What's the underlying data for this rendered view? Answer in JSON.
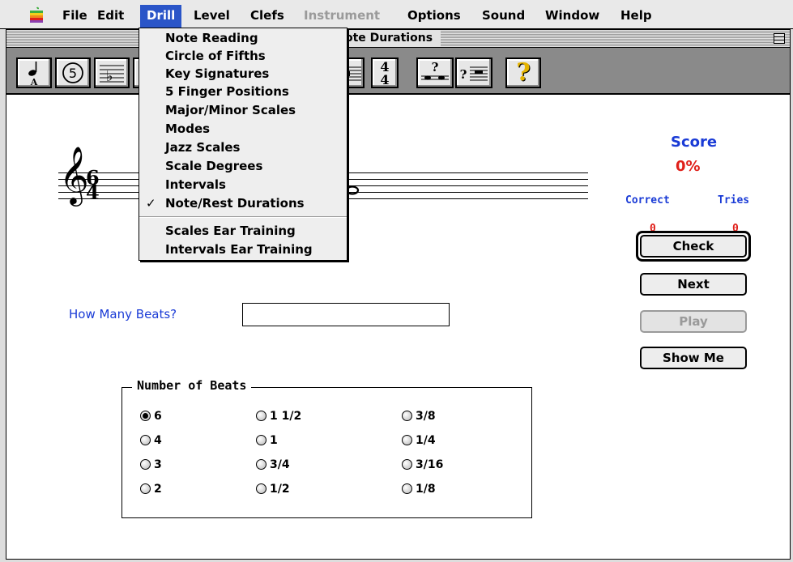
{
  "menubar": {
    "apple_icon": "apple-logo-icon",
    "items": [
      {
        "label": "File",
        "enabled": true
      },
      {
        "label": "Edit",
        "enabled": true
      },
      {
        "label": "Drill",
        "enabled": true,
        "active": true
      },
      {
        "label": "Level",
        "enabled": true
      },
      {
        "label": "Clefs",
        "enabled": true
      },
      {
        "label": "Instrument",
        "enabled": false
      },
      {
        "label": "Options",
        "enabled": true
      },
      {
        "label": "Sound",
        "enabled": true
      },
      {
        "label": "Window",
        "enabled": true
      },
      {
        "label": "Help",
        "enabled": true
      }
    ]
  },
  "drill_menu": {
    "items": [
      {
        "label": "Note Reading",
        "checked": false
      },
      {
        "label": "Circle of Fifths",
        "checked": false
      },
      {
        "label": "Key Signatures",
        "checked": false
      },
      {
        "label": "5 Finger Positions",
        "checked": false
      },
      {
        "label": "Major/Minor Scales",
        "checked": false
      },
      {
        "label": "Modes",
        "checked": false
      },
      {
        "label": "Jazz Scales",
        "checked": false
      },
      {
        "label": "Scale Degrees",
        "checked": false
      },
      {
        "label": "Intervals",
        "checked": false
      },
      {
        "label": "Note/Rest Durations",
        "checked": true
      },
      {
        "label": "Scales Ear Training",
        "checked": false
      },
      {
        "label": "Intervals Ear Training",
        "checked": false
      }
    ],
    "check_mark": "✓"
  },
  "window": {
    "title_visible": "ote Durations"
  },
  "toolbar": {
    "btn_note_letter": "A",
    "btn_circle_fifths": "5",
    "btn_time_sig_top": "4",
    "btn_time_sig_bottom": "4",
    "btn_ear_q": "?",
    "btn_help": "?"
  },
  "score": {
    "label": "Score",
    "value": "0%",
    "correct_label": "Correct",
    "tries_label": "Tries",
    "correct_value": "0",
    "tries_value": "0"
  },
  "staff": {
    "time_sig_top": "6",
    "time_sig_bottom": "4",
    "clef_glyph": "𝄞"
  },
  "buttons": {
    "check": "Check",
    "next": "Next",
    "play": "Play",
    "show_me": "Show Me"
  },
  "question": {
    "label": "How Many Beats?",
    "answer_value": ""
  },
  "beats_group": {
    "legend": "Number of Beats",
    "options": [
      {
        "label": "6",
        "selected": true
      },
      {
        "label": "4",
        "selected": false
      },
      {
        "label": "3",
        "selected": false
      },
      {
        "label": "2",
        "selected": false
      },
      {
        "label": "1 1/2",
        "selected": false
      },
      {
        "label": "1",
        "selected": false
      },
      {
        "label": "3/4",
        "selected": false
      },
      {
        "label": "1/2",
        "selected": false
      },
      {
        "label": "3/8",
        "selected": false
      },
      {
        "label": "1/4",
        "selected": false
      },
      {
        "label": "3/16",
        "selected": false
      },
      {
        "label": "1/8",
        "selected": false
      }
    ]
  },
  "colors": {
    "menu_highlight": "#2a55c8",
    "score_label": "#1a3bd6",
    "score_value": "#e0201a"
  }
}
